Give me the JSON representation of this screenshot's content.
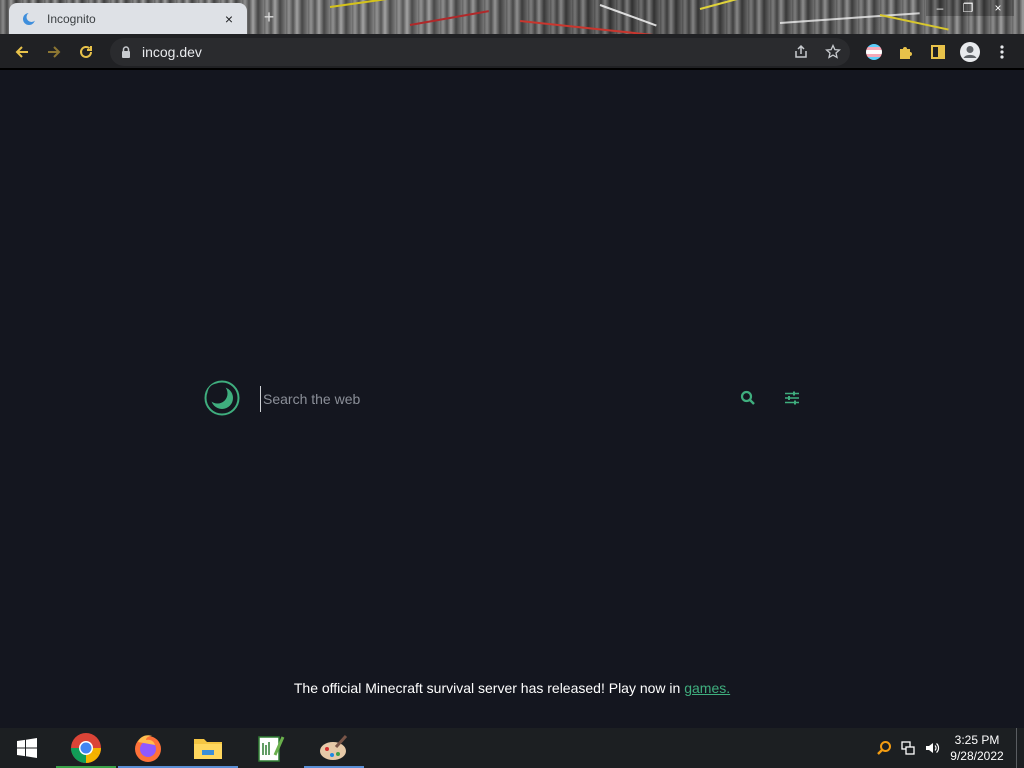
{
  "browser": {
    "tab": {
      "title": "Incognito",
      "close_glyph": "×"
    },
    "new_tab_glyph": "+",
    "window_controls": {
      "minimize": "–",
      "restore": "❐",
      "close": "×"
    },
    "address": {
      "url": "incog.dev"
    }
  },
  "page": {
    "search": {
      "placeholder": "Search the web"
    },
    "announcement": {
      "text": "The official Minecraft survival server has released! Play now in ",
      "link_text": "games."
    },
    "accent_color": "#3fae7e",
    "background_color": "#14161f"
  },
  "taskbar": {
    "items": [
      "start-button",
      "chrome-app",
      "firefox-app",
      "file-explorer-app",
      "notepad-app",
      "paint-app"
    ],
    "clock": {
      "time": "3:25 PM",
      "date": "9/28/2022"
    }
  }
}
